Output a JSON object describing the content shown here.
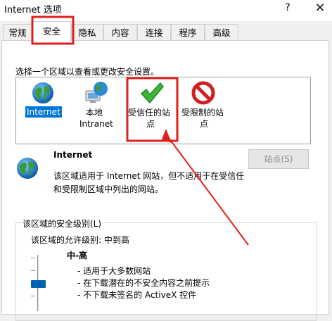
{
  "window": {
    "title": "Internet 选项",
    "help": "?",
    "close": "×"
  },
  "tabs": [
    "常规",
    "安全",
    "隐私",
    "内容",
    "连接",
    "程序",
    "高级"
  ],
  "active_tab": "安全",
  "security": {
    "zone_instruction": "选择一个区域以查看或更改安全设置。",
    "zones": [
      {
        "line1": "Internet",
        "line2": "",
        "icon": "globe-icon",
        "selected": true
      },
      {
        "line1": "本地",
        "line2": "Intranet",
        "icon": "intranet-globe-icon",
        "selected": false
      },
      {
        "line1": "受信任的站",
        "line2": "点",
        "icon": "green-check-icon",
        "selected": false
      },
      {
        "line1": "受限制的站",
        "line2": "点",
        "icon": "red-no-entry-icon",
        "selected": false
      }
    ],
    "selected_zone_name": "Internet",
    "description_line1": "该区域适用于 Internet 网站，但不适用于在受信任",
    "description_line2": "和受限制区域中列出的网站。",
    "sites_button": "站点(S)",
    "level_group_title": "该区域的安全级别(L)",
    "allowed_levels": "该区域的允许级别: 中到高",
    "level_name": "中-高",
    "level_bullets": [
      "- 适用于大多数网站",
      "- 在下载潜在的不安全内容之前提示",
      "- 不下载未签名的 ActiveX 控件"
    ]
  },
  "colors": {
    "highlight_border": "#e02020",
    "selection": "#0078d7",
    "slider_thumb": "#0063b1"
  }
}
